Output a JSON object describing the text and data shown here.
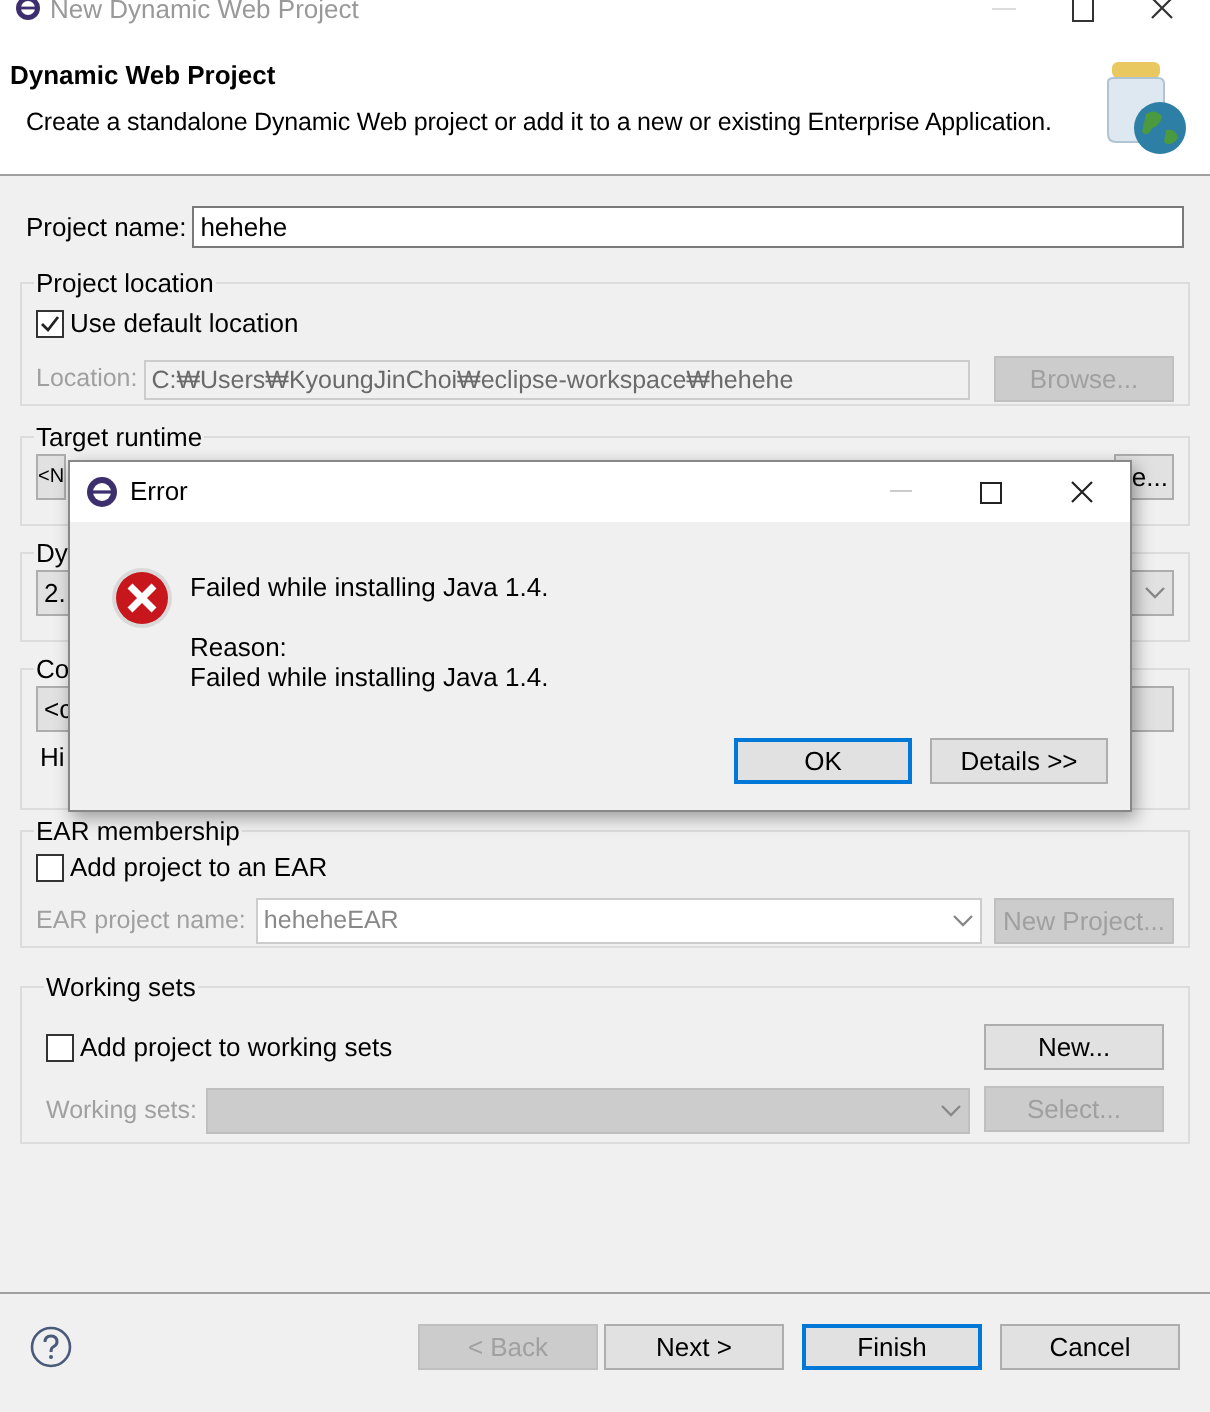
{
  "window": {
    "title": "New Dynamic Web Project"
  },
  "header": {
    "title": "Dynamic Web Project",
    "description": "Create a standalone Dynamic Web project or add it to a new or existing Enterprise Application."
  },
  "project_name": {
    "label": "Project name:",
    "value": "hehehe"
  },
  "project_location": {
    "title": "Project location",
    "use_default": {
      "label": "Use default location",
      "checked": true
    },
    "location": {
      "label": "Location:",
      "value": "C:₩Users₩KyoungJinChoi₩eclipse-workspace₩hehehe",
      "disabled": true
    },
    "browse_button": {
      "label": "Browse...",
      "disabled": true
    }
  },
  "target_runtime": {
    "title": "Target runtime",
    "combo_value": "<N",
    "button": "e..."
  },
  "module_version": {
    "title": "Dy",
    "combo_value": "2."
  },
  "configuration": {
    "title": "Co",
    "combo_value": "<c",
    "hint": "Hi"
  },
  "ear_membership": {
    "title": "EAR membership",
    "add_to_ear": {
      "label": "Add project to an EAR",
      "checked": false
    },
    "ear_name": {
      "label": "EAR project name:",
      "value": "heheheEAR",
      "disabled": true
    },
    "new_project_button": {
      "label": "New Project...",
      "disabled": true
    }
  },
  "working_sets": {
    "title": "Working sets",
    "add_to_sets": {
      "label": "Add project to working sets",
      "checked": false
    },
    "new_button": {
      "label": "New...",
      "disabled": false
    },
    "sets": {
      "label": "Working sets:",
      "disabled": true
    },
    "select_button": {
      "label": "Select...",
      "disabled": true
    }
  },
  "buttons": [
    {
      "label": "< Back",
      "disabled": true,
      "default": false
    },
    {
      "label": "Next >",
      "disabled": false,
      "default": false
    },
    {
      "label": "Finish",
      "disabled": false,
      "default": true
    },
    {
      "label": "Cancel",
      "disabled": false,
      "default": false
    }
  ],
  "error_dialog": {
    "title": "Error",
    "message": "Failed while installing Java 1.4.",
    "reason_label": "Reason:",
    "reason": "Failed while installing Java 1.4.",
    "buttons": [
      {
        "label": "OK",
        "default": true
      },
      {
        "label": "Details >>",
        "default": false
      }
    ]
  }
}
